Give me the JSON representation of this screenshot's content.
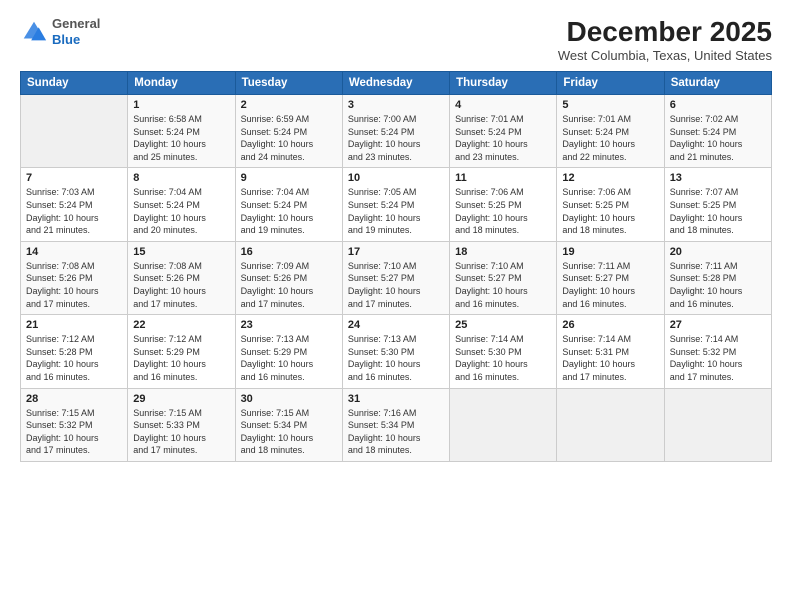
{
  "logo": {
    "general": "General",
    "blue": "Blue"
  },
  "header": {
    "month_year": "December 2025",
    "location": "West Columbia, Texas, United States"
  },
  "days_of_week": [
    "Sunday",
    "Monday",
    "Tuesday",
    "Wednesday",
    "Thursday",
    "Friday",
    "Saturday"
  ],
  "weeks": [
    [
      {
        "day": "",
        "info": ""
      },
      {
        "day": "1",
        "info": "Sunrise: 6:58 AM\nSunset: 5:24 PM\nDaylight: 10 hours\nand 25 minutes."
      },
      {
        "day": "2",
        "info": "Sunrise: 6:59 AM\nSunset: 5:24 PM\nDaylight: 10 hours\nand 24 minutes."
      },
      {
        "day": "3",
        "info": "Sunrise: 7:00 AM\nSunset: 5:24 PM\nDaylight: 10 hours\nand 23 minutes."
      },
      {
        "day": "4",
        "info": "Sunrise: 7:01 AM\nSunset: 5:24 PM\nDaylight: 10 hours\nand 23 minutes."
      },
      {
        "day": "5",
        "info": "Sunrise: 7:01 AM\nSunset: 5:24 PM\nDaylight: 10 hours\nand 22 minutes."
      },
      {
        "day": "6",
        "info": "Sunrise: 7:02 AM\nSunset: 5:24 PM\nDaylight: 10 hours\nand 21 minutes."
      }
    ],
    [
      {
        "day": "7",
        "info": "Sunrise: 7:03 AM\nSunset: 5:24 PM\nDaylight: 10 hours\nand 21 minutes."
      },
      {
        "day": "8",
        "info": "Sunrise: 7:04 AM\nSunset: 5:24 PM\nDaylight: 10 hours\nand 20 minutes."
      },
      {
        "day": "9",
        "info": "Sunrise: 7:04 AM\nSunset: 5:24 PM\nDaylight: 10 hours\nand 19 minutes."
      },
      {
        "day": "10",
        "info": "Sunrise: 7:05 AM\nSunset: 5:24 PM\nDaylight: 10 hours\nand 19 minutes."
      },
      {
        "day": "11",
        "info": "Sunrise: 7:06 AM\nSunset: 5:25 PM\nDaylight: 10 hours\nand 18 minutes."
      },
      {
        "day": "12",
        "info": "Sunrise: 7:06 AM\nSunset: 5:25 PM\nDaylight: 10 hours\nand 18 minutes."
      },
      {
        "day": "13",
        "info": "Sunrise: 7:07 AM\nSunset: 5:25 PM\nDaylight: 10 hours\nand 18 minutes."
      }
    ],
    [
      {
        "day": "14",
        "info": "Sunrise: 7:08 AM\nSunset: 5:26 PM\nDaylight: 10 hours\nand 17 minutes."
      },
      {
        "day": "15",
        "info": "Sunrise: 7:08 AM\nSunset: 5:26 PM\nDaylight: 10 hours\nand 17 minutes."
      },
      {
        "day": "16",
        "info": "Sunrise: 7:09 AM\nSunset: 5:26 PM\nDaylight: 10 hours\nand 17 minutes."
      },
      {
        "day": "17",
        "info": "Sunrise: 7:10 AM\nSunset: 5:27 PM\nDaylight: 10 hours\nand 17 minutes."
      },
      {
        "day": "18",
        "info": "Sunrise: 7:10 AM\nSunset: 5:27 PM\nDaylight: 10 hours\nand 16 minutes."
      },
      {
        "day": "19",
        "info": "Sunrise: 7:11 AM\nSunset: 5:27 PM\nDaylight: 10 hours\nand 16 minutes."
      },
      {
        "day": "20",
        "info": "Sunrise: 7:11 AM\nSunset: 5:28 PM\nDaylight: 10 hours\nand 16 minutes."
      }
    ],
    [
      {
        "day": "21",
        "info": "Sunrise: 7:12 AM\nSunset: 5:28 PM\nDaylight: 10 hours\nand 16 minutes."
      },
      {
        "day": "22",
        "info": "Sunrise: 7:12 AM\nSunset: 5:29 PM\nDaylight: 10 hours\nand 16 minutes."
      },
      {
        "day": "23",
        "info": "Sunrise: 7:13 AM\nSunset: 5:29 PM\nDaylight: 10 hours\nand 16 minutes."
      },
      {
        "day": "24",
        "info": "Sunrise: 7:13 AM\nSunset: 5:30 PM\nDaylight: 10 hours\nand 16 minutes."
      },
      {
        "day": "25",
        "info": "Sunrise: 7:14 AM\nSunset: 5:30 PM\nDaylight: 10 hours\nand 16 minutes."
      },
      {
        "day": "26",
        "info": "Sunrise: 7:14 AM\nSunset: 5:31 PM\nDaylight: 10 hours\nand 17 minutes."
      },
      {
        "day": "27",
        "info": "Sunrise: 7:14 AM\nSunset: 5:32 PM\nDaylight: 10 hours\nand 17 minutes."
      }
    ],
    [
      {
        "day": "28",
        "info": "Sunrise: 7:15 AM\nSunset: 5:32 PM\nDaylight: 10 hours\nand 17 minutes."
      },
      {
        "day": "29",
        "info": "Sunrise: 7:15 AM\nSunset: 5:33 PM\nDaylight: 10 hours\nand 17 minutes."
      },
      {
        "day": "30",
        "info": "Sunrise: 7:15 AM\nSunset: 5:34 PM\nDaylight: 10 hours\nand 18 minutes."
      },
      {
        "day": "31",
        "info": "Sunrise: 7:16 AM\nSunset: 5:34 PM\nDaylight: 10 hours\nand 18 minutes."
      },
      {
        "day": "",
        "info": ""
      },
      {
        "day": "",
        "info": ""
      },
      {
        "day": "",
        "info": ""
      }
    ]
  ]
}
